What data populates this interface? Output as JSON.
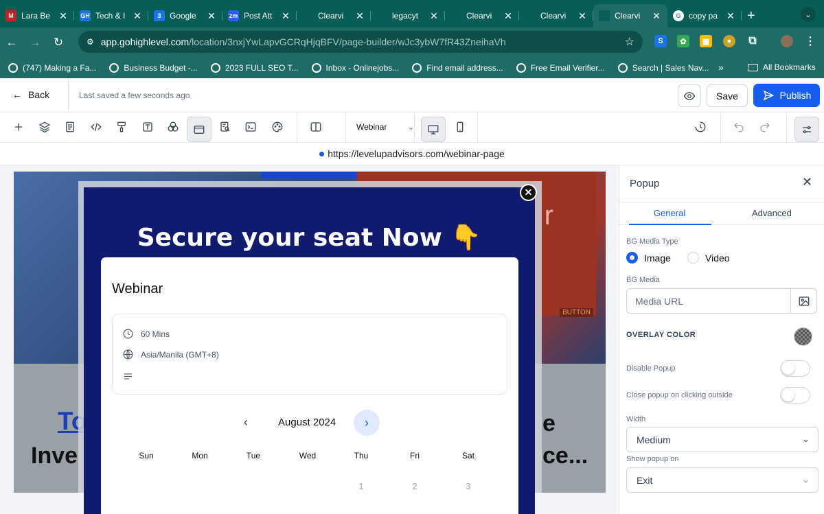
{
  "browser": {
    "tabs": [
      {
        "title": "Lara Be",
        "icon": "gmail-icon",
        "color": "#c5221f",
        "glyph": "M"
      },
      {
        "title": "Tech & I",
        "icon": "ghl-icon",
        "color": "#1a73e8",
        "glyph": "GH"
      },
      {
        "title": "Google",
        "icon": "google-sheets-icon",
        "color": "#1a73e8",
        "glyph": "3"
      },
      {
        "title": "Post Att",
        "icon": "zoom-icon",
        "color": "#2d5cf6",
        "glyph": "zm"
      },
      {
        "title": "Clearvi",
        "icon": "page-icon",
        "color": "#075e57",
        "glyph": ""
      },
      {
        "title": "legacyt",
        "icon": "page-icon",
        "color": "#075e57",
        "glyph": ""
      },
      {
        "title": "Clearvi",
        "icon": "page-icon",
        "color": "#075e57",
        "glyph": ""
      },
      {
        "title": "Clearvi",
        "icon": "page-icon",
        "color": "#075e57",
        "glyph": ""
      },
      {
        "title": "Clearvi",
        "icon": "page-icon",
        "color": "#075e57",
        "glyph": "",
        "active": true
      },
      {
        "title": "copy pa",
        "icon": "google-icon",
        "color": "#fff",
        "glyph": "G"
      }
    ],
    "url_domain": "app.gohighlevel.com",
    "url_path": "/location/3nxjYwLapvGCRqHjqBFV/page-builder/wJc3ybW7fR43ZneihaVh",
    "bookmarks": [
      "(747) Making a Fa...",
      "Business Budget -...",
      "2023 FULL SEO T...",
      "Inbox - Onlinejobs...",
      "Find email address...",
      "Free Email Verifier...",
      "Search | Sales Nav..."
    ],
    "all_bookmarks": "All Bookmarks",
    "more": "»"
  },
  "app": {
    "back": "Back",
    "saved": "Last saved a few seconds ago",
    "save": "Save",
    "publish": "Publish",
    "template": "Webinar",
    "preview_url": "https://levelupadvisors.com/webinar-page"
  },
  "canvas": {
    "button_tag": "BUTTON",
    "partial_text_1": "To",
    "partial_text_2": "Inve",
    "partial_text_3": "e",
    "partial_text_4": "ce...",
    "partial_r": "r"
  },
  "popup": {
    "title": "Secure your seat Now 👇",
    "card_title": "Webinar",
    "duration": "60 Mins",
    "timezone": "Asia/Manila (GMT+8)",
    "month": "August 2024",
    "weekdays": [
      "Sun",
      "Mon",
      "Tue",
      "Wed",
      "Thu",
      "Fri",
      "Sat"
    ],
    "days": [
      "1",
      "2",
      "3"
    ]
  },
  "panel": {
    "title": "Popup",
    "tab_general": "General",
    "tab_advanced": "Advanced",
    "bg_media_type": "BG Media Type",
    "opt_image": "Image",
    "opt_video": "Video",
    "bg_media": "BG Media",
    "media_placeholder": "Media URL",
    "overlay_color": "OVERLAY COLOR",
    "disable_popup": "Disable Popup",
    "close_outside": "Close popup on clicking outside",
    "width_label": "Width",
    "width_value": "Medium",
    "show_on_label": "Show popup on",
    "show_on_value": "Exit"
  }
}
